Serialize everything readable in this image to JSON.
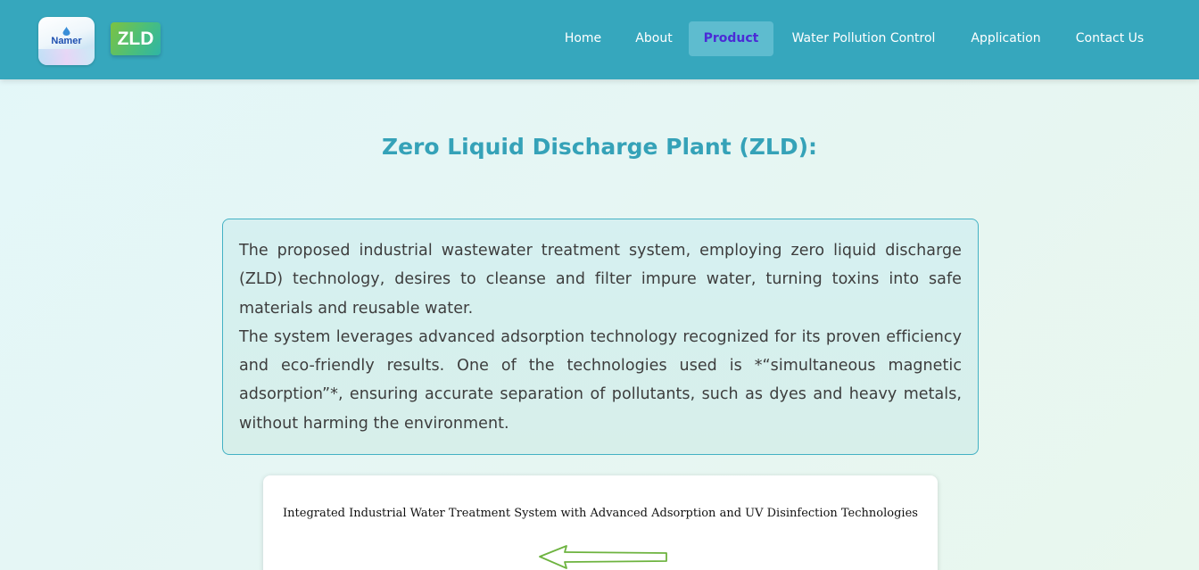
{
  "header": {
    "logo_primary_text": "Namer",
    "logo_secondary_text": "ZLD",
    "nav": [
      {
        "label": "Home",
        "active": false
      },
      {
        "label": "About",
        "active": false
      },
      {
        "label": "Product",
        "active": true
      },
      {
        "label": "Water Pollution Control",
        "active": false
      },
      {
        "label": "Application",
        "active": false
      },
      {
        "label": "Contact Us",
        "active": false
      }
    ]
  },
  "main": {
    "title": "Zero Liquid Discharge Plant (ZLD):",
    "paragraphs": [
      "The proposed industrial wastewater treatment system, employing zero liquid discharge (ZLD) technology, desires to cleanse and filter impure water, turning toxins into safe materials and reusable water.",
      "The system leverages advanced adsorption technology recognized for its proven efficiency and eco-friendly results. One of the technologies used is *“simultaneous magnetic adsorption”*, ensuring accurate separation of pollutants, such as dyes and heavy metals, without harming the environment."
    ],
    "diagram": {
      "title": "Integrated Industrial Water Treatment System with Advanced Adsorption and UV Disinfection Technologies",
      "arrow_icon": "arrow-left-icon"
    }
  },
  "colors": {
    "header_bg": "#36a7bd",
    "title": "#35a2b8",
    "active_nav_text": "#4b2bd6",
    "active_nav_bg": "#5ebccf",
    "box_border": "#43b1c4",
    "arrow": "#6db33f"
  }
}
